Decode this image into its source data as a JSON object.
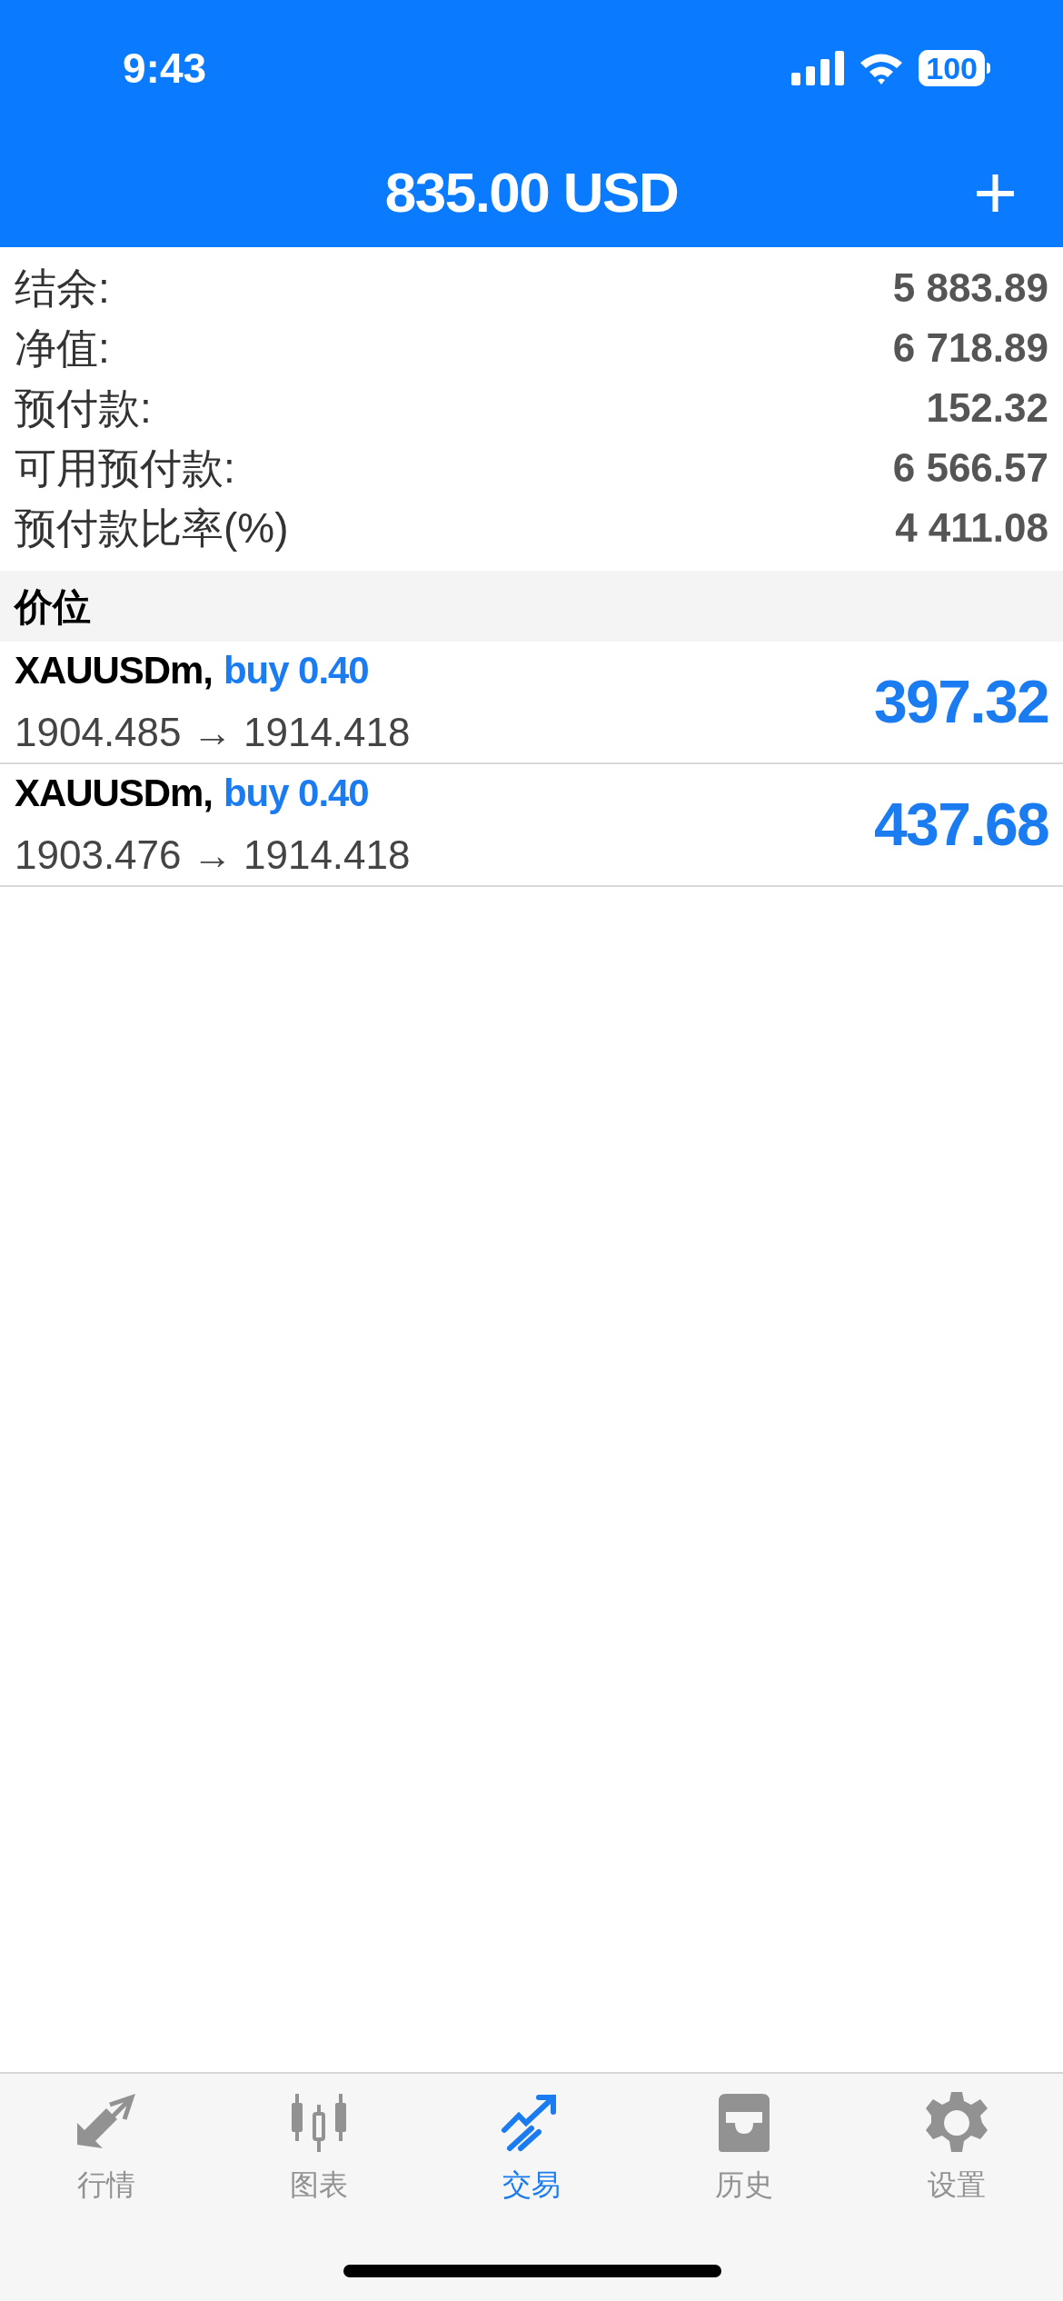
{
  "status_bar": {
    "time": "9:43",
    "battery": "100"
  },
  "header": {
    "title": "835.00 USD",
    "add": "+"
  },
  "summary": [
    {
      "label": "结余:",
      "value": "5 883.89"
    },
    {
      "label": "净值:",
      "value": "6 718.89"
    },
    {
      "label": "预付款:",
      "value": "152.32"
    },
    {
      "label": "可用预付款:",
      "value": "6 566.57"
    },
    {
      "label": "预付款比率(%)",
      "value": "4 411.08"
    }
  ],
  "section": {
    "title": "价位"
  },
  "positions": [
    {
      "symbol": "XAUUSDm,",
      "side": "buy 0.40",
      "prices": "1904.485 → 1914.418",
      "profit": "397.32"
    },
    {
      "symbol": "XAUUSDm,",
      "side": "buy 0.40",
      "prices": "1903.476 → 1914.418",
      "profit": "437.68"
    }
  ],
  "tabs": [
    {
      "kind": "quotes",
      "label": "行情",
      "selected": false
    },
    {
      "kind": "chart",
      "label": "图表",
      "selected": false
    },
    {
      "kind": "trade",
      "label": "交易",
      "selected": true
    },
    {
      "kind": "history",
      "label": "历史",
      "selected": false
    },
    {
      "kind": "settings",
      "label": "设置",
      "selected": false
    }
  ]
}
